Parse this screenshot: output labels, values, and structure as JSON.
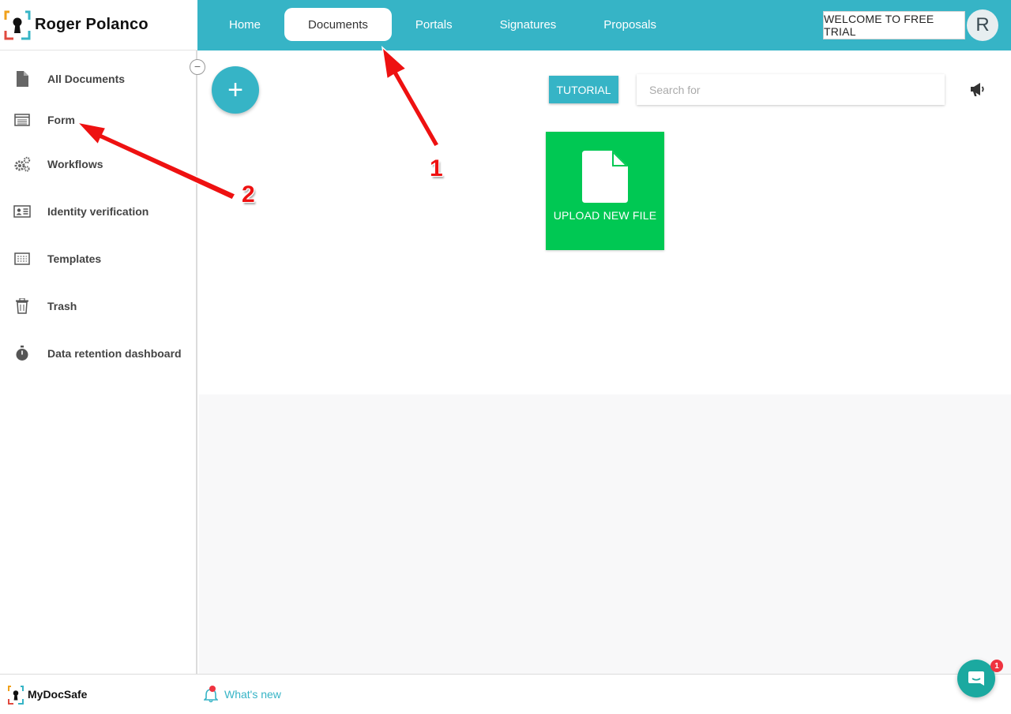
{
  "brand": {
    "name": "Roger Polanco"
  },
  "nav": {
    "tabs": [
      {
        "label": "Home",
        "active": false
      },
      {
        "label": "Documents",
        "active": true
      },
      {
        "label": "Portals",
        "active": false
      },
      {
        "label": "Signatures",
        "active": false
      },
      {
        "label": "Proposals",
        "active": false
      }
    ]
  },
  "header": {
    "trial_label": "WELCOME TO FREE TRIAL",
    "avatar_initial": "R"
  },
  "sidebar": {
    "items": [
      {
        "label": "All Documents",
        "icon": "document-icon"
      },
      {
        "label": "Form",
        "icon": "form-icon"
      },
      {
        "label": "Workflows",
        "icon": "gears-icon"
      },
      {
        "label": "Identity verification",
        "icon": "id-card-icon"
      },
      {
        "label": "Templates",
        "icon": "template-icon"
      },
      {
        "label": "Trash",
        "icon": "trash-icon"
      },
      {
        "label": "Data retention dashboard",
        "icon": "stopwatch-icon"
      }
    ],
    "collapse_symbol": "−"
  },
  "toolbar": {
    "add_symbol": "+",
    "tutorial_label": "TUTORIAL",
    "search_placeholder": "Search for"
  },
  "upload": {
    "label": "UPLOAD NEW FILE"
  },
  "annotations": {
    "first": "1",
    "second": "2"
  },
  "footer": {
    "brand": "MyDocSafe",
    "whats_new": "What's new"
  },
  "chat": {
    "badge_count": "1"
  },
  "colors": {
    "accent": "#36b4c6",
    "upload": "#00c853",
    "annotation": "#e11111",
    "chat": "#1ba9a0"
  }
}
